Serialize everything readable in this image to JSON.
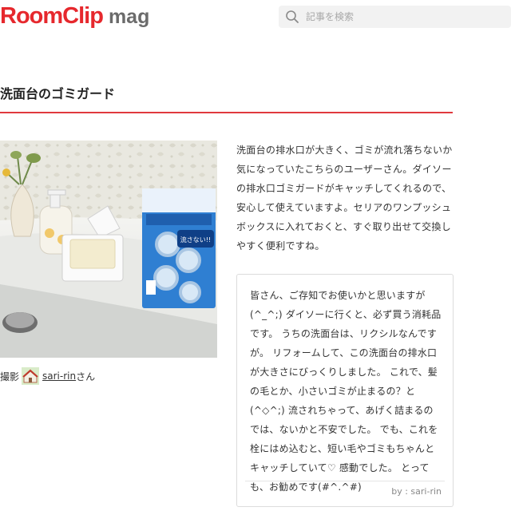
{
  "header": {
    "logo_main": "RoomClip",
    "logo_sub": "mag",
    "search_placeholder": "記事を検索",
    "brand_color": "#e6282d"
  },
  "article": {
    "title": "洗面台のゴミガード",
    "title_rule_color": "#e0393e",
    "photo_credit": {
      "prefix": "撮影",
      "username": "sari-rin",
      "suffix": "さん"
    },
    "description": "洗面台の排水口が大きく、ゴミが流れ落ちないか気になっていたこちらのユーザーさん。ダイソーの排水口ゴミガードがキャッチしてくれるので、安心して使えていますよ。セリアのワンプッシュボックスに入れておくと、すぐ取り出せて交換しやすく便利ですね。",
    "quote": {
      "text": "皆さん、ご存知でお使いかと思いますが(^_^;) ダイソーに行くと、必ず買う消耗品です。 うちの洗面台は、リクシルなんですが。 リフォームして、この洗面台の排水口が大きさにびっくりしました。 これで、髪の毛とか、小さいゴミが止まるの？と(^◇^;) 流されちゃって、あげく詰まるのでは、ないかと不安でした。 でも、これを栓にはめ込むと、短い毛やゴミもちゃんとキャッチしていて♡ 感動でした。 とっても、お勧めです(#^.^#)",
      "by": "by : sari-rin"
    },
    "package_text": "流さない!!"
  }
}
